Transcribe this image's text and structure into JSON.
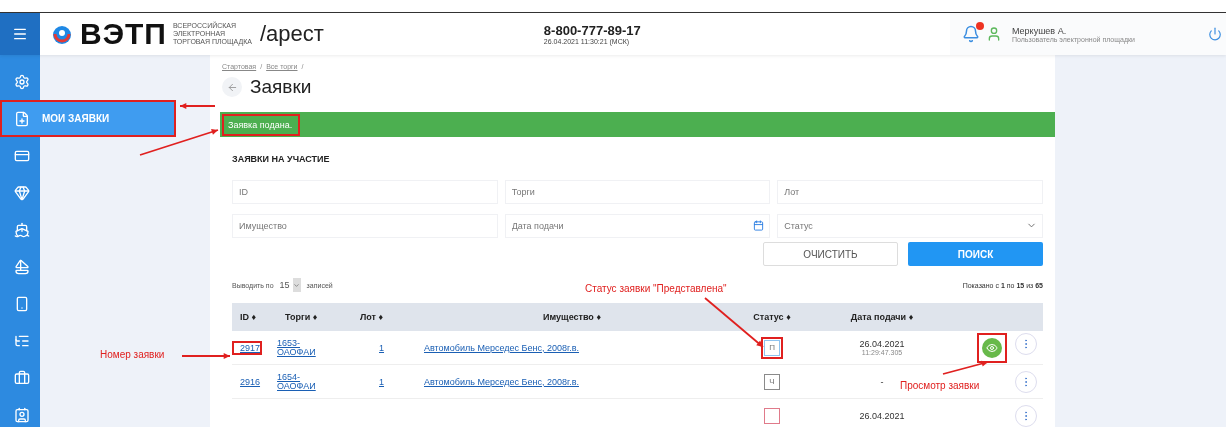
{
  "header": {
    "logo_text": "ВЭТП",
    "logo_subtitle": [
      "ВСЕРОССИЙСКАЯ",
      "ЭЛЕКТРОННАЯ",
      "ТОРГОВАЯ ПЛОЩАДКА"
    ],
    "section": "/арест",
    "phone": "8-800-777-89-17",
    "datetime": "26.04.2021 11:30:21 (МСК)",
    "user": {
      "name": "Меркушев А.",
      "role": "Пользователь электронной площадки"
    }
  },
  "sidebar": {
    "items": [
      {
        "selected": false
      },
      {
        "label": "МОИ ЗАЯВКИ",
        "selected": true,
        "highlighted": true
      },
      {
        "selected": false
      },
      {
        "selected": false
      },
      {
        "selected": false
      },
      {
        "selected": false
      },
      {
        "selected": false
      },
      {
        "selected": false
      },
      {
        "selected": false
      },
      {
        "selected": false
      }
    ]
  },
  "breadcrumbs": [
    {
      "kind": "link",
      "text": "Стартовая"
    },
    {
      "kind": "separator",
      "text": "/"
    },
    {
      "kind": "link",
      "text": "Все торги"
    },
    {
      "kind": "separator",
      "text": "/"
    }
  ],
  "page_title": "Заявки",
  "notice": {
    "text": "Заявка подана.",
    "highlighted": true
  },
  "card": {
    "title": "ЗАЯВКИ НА УЧАСТИЕ",
    "filters": [
      {
        "placeholder": "ID",
        "kind": "text"
      },
      {
        "placeholder": "Торги",
        "kind": "text"
      },
      {
        "placeholder": "Лот",
        "kind": "text"
      },
      {
        "placeholder": "Имущество",
        "kind": "text"
      },
      {
        "placeholder": "Дата подачи",
        "kind": "date"
      },
      {
        "placeholder": "Статус",
        "kind": "select"
      }
    ],
    "buttons": [
      {
        "label": "ОЧИСТИТЬ",
        "kind": "secondary"
      },
      {
        "label": "ПОИСК",
        "kind": "primary"
      }
    ],
    "page_size": {
      "prefix": "Выводить по",
      "value": "15",
      "suffix": "записей"
    },
    "summary": "Показано с **1** по **15** из **65**"
  },
  "table": {
    "sort_mark": "♦",
    "columns": [
      "ID",
      "Торги",
      "Лот",
      "Имущество",
      "Статус",
      "Дата подачи"
    ],
    "rows": [
      {
        "id": "2917",
        "id_highlighted": true,
        "auction": "1653-ОАОФАИ",
        "lot": "1",
        "property": "Автомобиль Мерседес Бенс, 2008г.в.",
        "status": "П",
        "color": "#8fc3ef",
        "status_highlighted": true,
        "date": "26.04.2021",
        "time": "11:29:47.305",
        "view_button": true,
        "view_highlighted": true
      },
      {
        "id": "2916",
        "auction": "1654-ОАОФАИ",
        "lot": "1",
        "property": "Автомобиль Мерседес Бенс, 2008г.в.",
        "status": "Ч",
        "color": "#8a8a8a",
        "date": "-"
      },
      {
        "color": "#e07a8a",
        "date": "26.04.2021"
      }
    ]
  },
  "annotations": [
    {
      "text": "Номер заявки"
    },
    {
      "text": "Статус заявки \"Представлена\""
    },
    {
      "text": "Просмотр заявки"
    }
  ]
}
